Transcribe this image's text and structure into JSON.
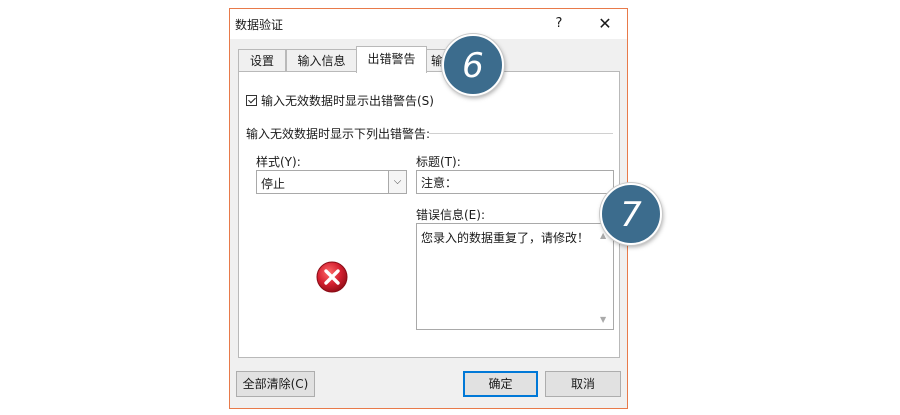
{
  "dialog": {
    "title": "数据验证",
    "help_label": "?",
    "close_label": "✕"
  },
  "tabs": [
    {
      "label": "设置"
    },
    {
      "label": "输入信息"
    },
    {
      "label": "出错警告",
      "active": true
    },
    {
      "label": "输"
    }
  ],
  "panel": {
    "show_error_checkbox_label": "输入无效数据时显示出错警告(S)",
    "show_error_checked": true,
    "group_label": "输入无效数据时显示下列出错警告:",
    "style_label": "样式(Y):",
    "style_value": "停止",
    "title_label": "标题(T):",
    "title_value": "注意：",
    "error_label": "错误信息(E):",
    "error_value": "您录入的数据重复了，请修改！",
    "icon": "stop-error-icon"
  },
  "buttons": {
    "clear_all": "全部清除(C)",
    "ok": "确定",
    "cancel": "取消"
  },
  "badges": {
    "step6": "6",
    "step7": "7"
  },
  "colors": {
    "badge": "#3c6c8d",
    "focus": "#0078d7",
    "window_border": "#e87a4a",
    "stop_icon": "#d42030"
  }
}
